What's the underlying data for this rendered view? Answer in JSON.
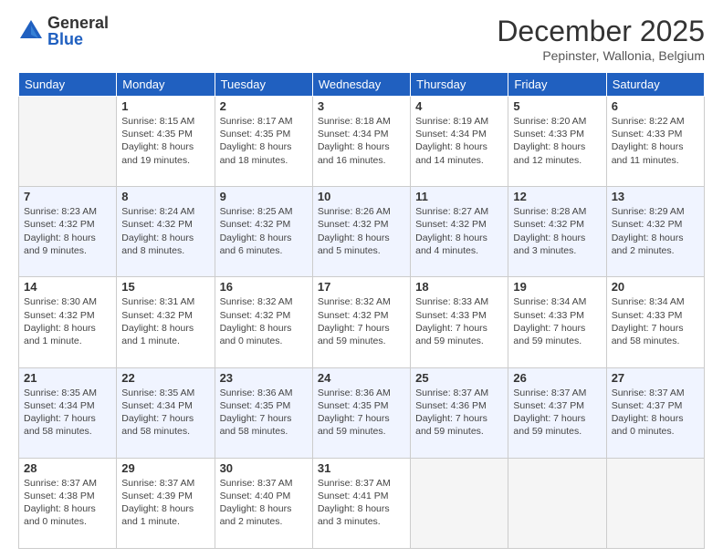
{
  "logo": {
    "general": "General",
    "blue": "Blue"
  },
  "title": "December 2025",
  "location": "Pepinster, Wallonia, Belgium",
  "days_of_week": [
    "Sunday",
    "Monday",
    "Tuesday",
    "Wednesday",
    "Thursday",
    "Friday",
    "Saturday"
  ],
  "weeks": [
    [
      {
        "num": "",
        "info": ""
      },
      {
        "num": "1",
        "info": "Sunrise: 8:15 AM\nSunset: 4:35 PM\nDaylight: 8 hours\nand 19 minutes."
      },
      {
        "num": "2",
        "info": "Sunrise: 8:17 AM\nSunset: 4:35 PM\nDaylight: 8 hours\nand 18 minutes."
      },
      {
        "num": "3",
        "info": "Sunrise: 8:18 AM\nSunset: 4:34 PM\nDaylight: 8 hours\nand 16 minutes."
      },
      {
        "num": "4",
        "info": "Sunrise: 8:19 AM\nSunset: 4:34 PM\nDaylight: 8 hours\nand 14 minutes."
      },
      {
        "num": "5",
        "info": "Sunrise: 8:20 AM\nSunset: 4:33 PM\nDaylight: 8 hours\nand 12 minutes."
      },
      {
        "num": "6",
        "info": "Sunrise: 8:22 AM\nSunset: 4:33 PM\nDaylight: 8 hours\nand 11 minutes."
      }
    ],
    [
      {
        "num": "7",
        "info": "Sunrise: 8:23 AM\nSunset: 4:32 PM\nDaylight: 8 hours\nand 9 minutes."
      },
      {
        "num": "8",
        "info": "Sunrise: 8:24 AM\nSunset: 4:32 PM\nDaylight: 8 hours\nand 8 minutes."
      },
      {
        "num": "9",
        "info": "Sunrise: 8:25 AM\nSunset: 4:32 PM\nDaylight: 8 hours\nand 6 minutes."
      },
      {
        "num": "10",
        "info": "Sunrise: 8:26 AM\nSunset: 4:32 PM\nDaylight: 8 hours\nand 5 minutes."
      },
      {
        "num": "11",
        "info": "Sunrise: 8:27 AM\nSunset: 4:32 PM\nDaylight: 8 hours\nand 4 minutes."
      },
      {
        "num": "12",
        "info": "Sunrise: 8:28 AM\nSunset: 4:32 PM\nDaylight: 8 hours\nand 3 minutes."
      },
      {
        "num": "13",
        "info": "Sunrise: 8:29 AM\nSunset: 4:32 PM\nDaylight: 8 hours\nand 2 minutes."
      }
    ],
    [
      {
        "num": "14",
        "info": "Sunrise: 8:30 AM\nSunset: 4:32 PM\nDaylight: 8 hours\nand 1 minute."
      },
      {
        "num": "15",
        "info": "Sunrise: 8:31 AM\nSunset: 4:32 PM\nDaylight: 8 hours\nand 1 minute."
      },
      {
        "num": "16",
        "info": "Sunrise: 8:32 AM\nSunset: 4:32 PM\nDaylight: 8 hours\nand 0 minutes."
      },
      {
        "num": "17",
        "info": "Sunrise: 8:32 AM\nSunset: 4:32 PM\nDaylight: 7 hours\nand 59 minutes."
      },
      {
        "num": "18",
        "info": "Sunrise: 8:33 AM\nSunset: 4:33 PM\nDaylight: 7 hours\nand 59 minutes."
      },
      {
        "num": "19",
        "info": "Sunrise: 8:34 AM\nSunset: 4:33 PM\nDaylight: 7 hours\nand 59 minutes."
      },
      {
        "num": "20",
        "info": "Sunrise: 8:34 AM\nSunset: 4:33 PM\nDaylight: 7 hours\nand 58 minutes."
      }
    ],
    [
      {
        "num": "21",
        "info": "Sunrise: 8:35 AM\nSunset: 4:34 PM\nDaylight: 7 hours\nand 58 minutes."
      },
      {
        "num": "22",
        "info": "Sunrise: 8:35 AM\nSunset: 4:34 PM\nDaylight: 7 hours\nand 58 minutes."
      },
      {
        "num": "23",
        "info": "Sunrise: 8:36 AM\nSunset: 4:35 PM\nDaylight: 7 hours\nand 58 minutes."
      },
      {
        "num": "24",
        "info": "Sunrise: 8:36 AM\nSunset: 4:35 PM\nDaylight: 7 hours\nand 59 minutes."
      },
      {
        "num": "25",
        "info": "Sunrise: 8:37 AM\nSunset: 4:36 PM\nDaylight: 7 hours\nand 59 minutes."
      },
      {
        "num": "26",
        "info": "Sunrise: 8:37 AM\nSunset: 4:37 PM\nDaylight: 7 hours\nand 59 minutes."
      },
      {
        "num": "27",
        "info": "Sunrise: 8:37 AM\nSunset: 4:37 PM\nDaylight: 8 hours\nand 0 minutes."
      }
    ],
    [
      {
        "num": "28",
        "info": "Sunrise: 8:37 AM\nSunset: 4:38 PM\nDaylight: 8 hours\nand 0 minutes."
      },
      {
        "num": "29",
        "info": "Sunrise: 8:37 AM\nSunset: 4:39 PM\nDaylight: 8 hours\nand 1 minute."
      },
      {
        "num": "30",
        "info": "Sunrise: 8:37 AM\nSunset: 4:40 PM\nDaylight: 8 hours\nand 2 minutes."
      },
      {
        "num": "31",
        "info": "Sunrise: 8:37 AM\nSunset: 4:41 PM\nDaylight: 8 hours\nand 3 minutes."
      },
      {
        "num": "",
        "info": ""
      },
      {
        "num": "",
        "info": ""
      },
      {
        "num": "",
        "info": ""
      }
    ]
  ]
}
